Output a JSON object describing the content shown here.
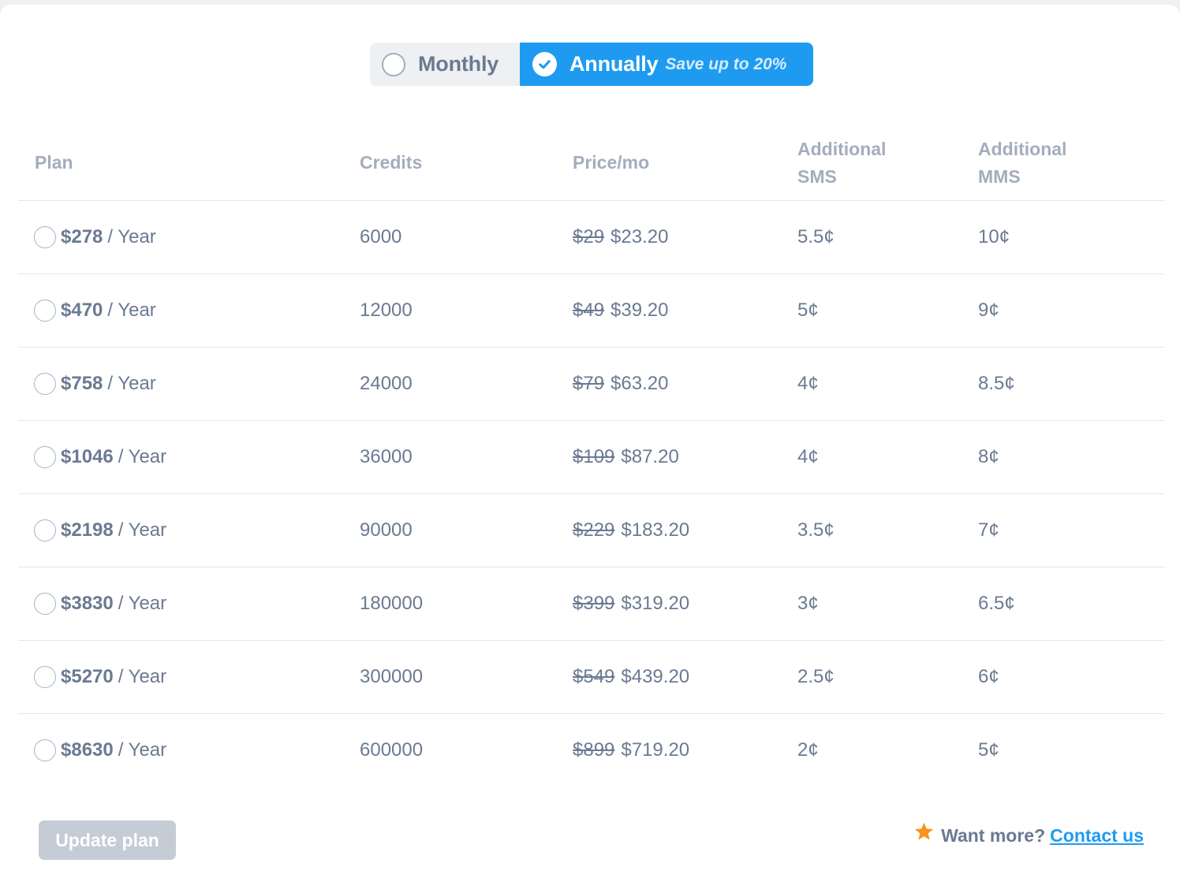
{
  "billing_toggle": {
    "monthly_label": "Monthly",
    "annual_label": "Annually",
    "save_badge": "Save up to 20%",
    "selected": "annual"
  },
  "table": {
    "headers": {
      "plan": "Plan",
      "credits": "Credits",
      "price": "Price/mo",
      "sms_line1": "Additional",
      "sms_line2": "SMS",
      "mms_line1": "Additional",
      "mms_line2": "MMS"
    },
    "rows": [
      {
        "amount": "$278",
        "period": "/ Year",
        "credits": "6000",
        "old_price": "$29",
        "new_price": "$23.20",
        "sms": "5.5¢",
        "mms": "10¢"
      },
      {
        "amount": "$470",
        "period": "/ Year",
        "credits": "12000",
        "old_price": "$49",
        "new_price": "$39.20",
        "sms": "5¢",
        "mms": "9¢"
      },
      {
        "amount": "$758",
        "period": "/ Year",
        "credits": "24000",
        "old_price": "$79",
        "new_price": "$63.20",
        "sms": "4¢",
        "mms": "8.5¢"
      },
      {
        "amount": "$1046",
        "period": "/ Year",
        "credits": "36000",
        "old_price": "$109",
        "new_price": "$87.20",
        "sms": "4¢",
        "mms": "8¢"
      },
      {
        "amount": "$2198",
        "period": "/ Year",
        "credits": "90000",
        "old_price": "$229",
        "new_price": "$183.20",
        "sms": "3.5¢",
        "mms": "7¢"
      },
      {
        "amount": "$3830",
        "period": "/ Year",
        "credits": "180000",
        "old_price": "$399",
        "new_price": "$319.20",
        "sms": "3¢",
        "mms": "6.5¢"
      },
      {
        "amount": "$5270",
        "period": "/ Year",
        "credits": "300000",
        "old_price": "$549",
        "new_price": "$439.20",
        "sms": "2.5¢",
        "mms": "6¢"
      },
      {
        "amount": "$8630",
        "period": "/ Year",
        "credits": "600000",
        "old_price": "$899",
        "new_price": "$719.20",
        "sms": "2¢",
        "mms": "5¢"
      }
    ]
  },
  "footer": {
    "update_button": "Update plan",
    "want_more": "Want more?",
    "contact_link": "Contact us"
  },
  "colors": {
    "accent": "#1e9bf0",
    "text": "#6b7a92",
    "muted_header": "#a3adbd",
    "disabled_button": "#c5ccd6",
    "star": "#f7931e"
  }
}
